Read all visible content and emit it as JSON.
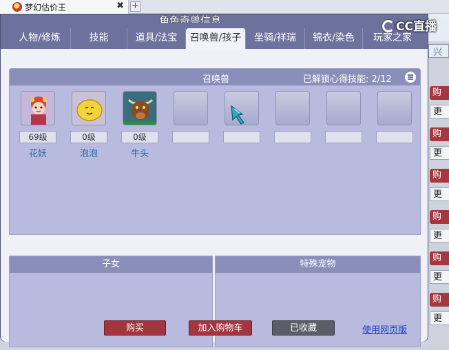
{
  "browser": {
    "tab_title": "梦幻估价王",
    "close_glyph": "✖",
    "new_tab_glyph": "+"
  },
  "brand": "CC直播",
  "panel": {
    "title": "角色奇兽信息",
    "tabs": [
      "人物/修炼",
      "技能",
      "道具/法宝",
      "召唤兽/孩子",
      "坐骑/祥瑞",
      "锦衣/染色",
      "玩家之家"
    ],
    "active_tab": 3
  },
  "summon": {
    "header": "召唤兽",
    "skills_label": "已解锁心得技能",
    "skills_value": "2/12",
    "pets": [
      {
        "name": "花妖",
        "level": "69级",
        "icon": "flower-demon-icon"
      },
      {
        "name": "泡泡",
        "level": "0级",
        "icon": "bubble-icon"
      },
      {
        "name": "牛头",
        "level": "0级",
        "icon": "bull-head-icon"
      }
    ],
    "empty_slots": 5
  },
  "children_header": "子女",
  "special_pets_header": "特殊宠物",
  "actions": {
    "buy": "购买",
    "add_cart": "加入购物车",
    "favorited": "已收藏",
    "web_version": "使用网页版"
  },
  "side": {
    "top": "兴",
    "red_glyph": "购",
    "white_glyph": "更"
  },
  "colors": {
    "panel": "#6d729c",
    "box": "#b8bbdd",
    "red_button": "#a2353d",
    "gray_button": "#5b5d66",
    "pet_name": "#2a6aa0"
  }
}
